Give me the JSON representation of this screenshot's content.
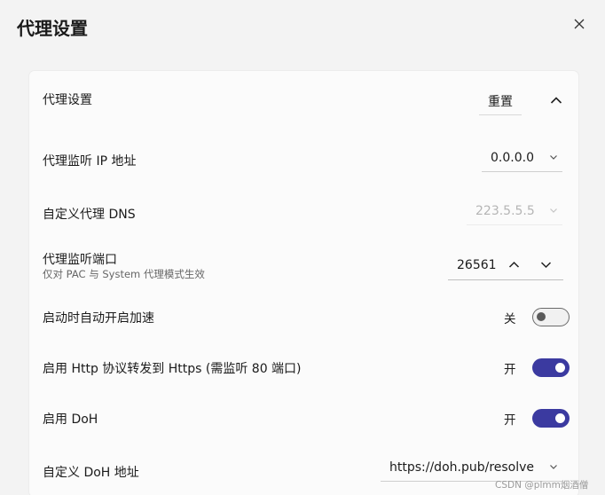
{
  "dialog": {
    "title": "代理设置",
    "close_glyph": "✕"
  },
  "section": {
    "title": "代理设置",
    "reset_label": "重置"
  },
  "listen_ip": {
    "label": "代理监听 IP 地址",
    "value": "0.0.0.0"
  },
  "custom_dns": {
    "label": "自定义代理 DNS",
    "value": "223.5.5.5",
    "disabled": true
  },
  "listen_port": {
    "label": "代理监听端口",
    "sublabel": "仅对 PAC 与 System 代理模式生效",
    "value": "26561"
  },
  "auto_start": {
    "label": "启动时自动开启加速",
    "state_label": "关",
    "on": false
  },
  "http_forward": {
    "label": "启用 Http 协议转发到 Https (需监听 80 端口)",
    "state_label": "开",
    "on": true
  },
  "doh": {
    "label": "启用 DoH",
    "state_label": "开",
    "on": true
  },
  "custom_doh": {
    "label": "自定义 DoH 地址",
    "value": "https://doh.pub/resolve"
  },
  "watermark": "CSDN @plmm烟酒僧",
  "colors": {
    "accent": "#3b3aa0",
    "background": "#f3f3f3",
    "card": "#fbfbfb"
  }
}
